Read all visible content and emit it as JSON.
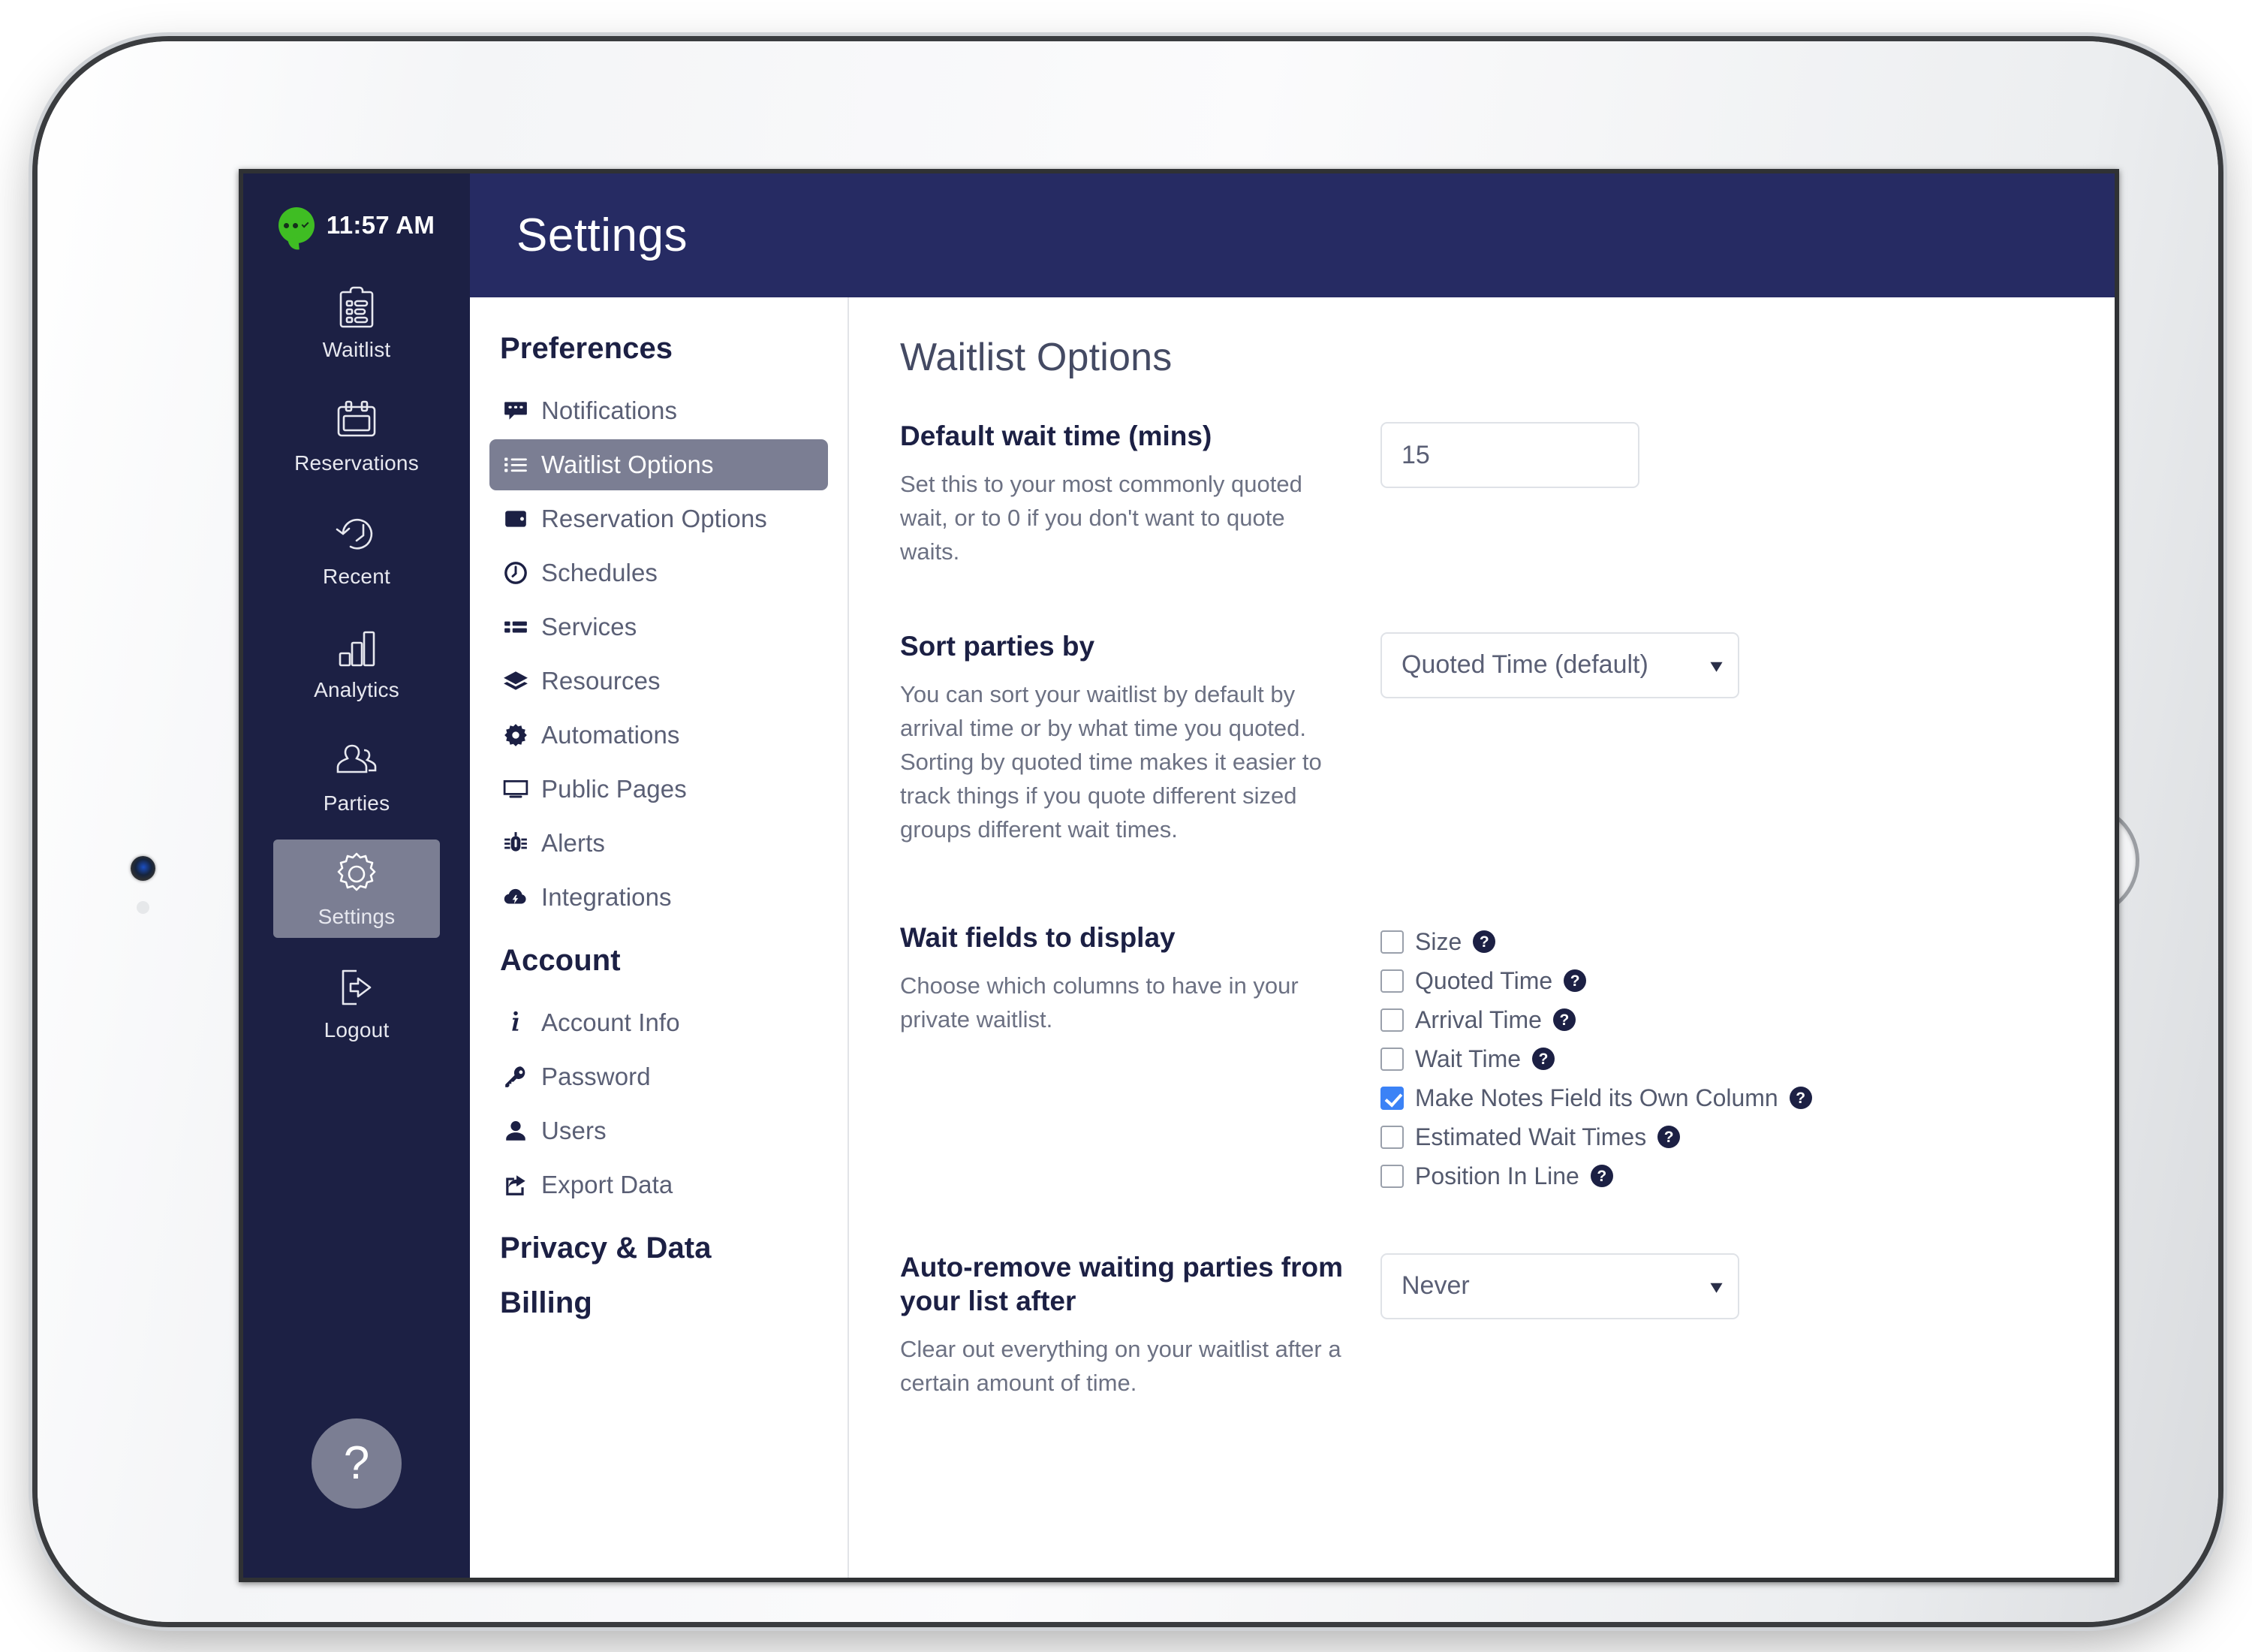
{
  "device": {
    "home_button": "home-button",
    "camera": "front-camera"
  },
  "status_bar": {
    "time": "11:57 AM",
    "logo_icon": "chat-bubble-logo"
  },
  "icon_rail": {
    "items": [
      {
        "label": "Waitlist",
        "icon": "clipboard-list-icon",
        "active": false
      },
      {
        "label": "Reservations",
        "icon": "calendar-icon",
        "active": false
      },
      {
        "label": "Recent",
        "icon": "clock-back-icon",
        "active": false
      },
      {
        "label": "Analytics",
        "icon": "bar-chart-icon",
        "active": false
      },
      {
        "label": "Parties",
        "icon": "people-icon",
        "active": false
      },
      {
        "label": "Settings",
        "icon": "gear-icon",
        "active": true
      },
      {
        "label": "Logout",
        "icon": "logout-icon",
        "active": false
      }
    ],
    "help_label": "?"
  },
  "title_bar": {
    "title": "Settings"
  },
  "prefs": {
    "heading_preferences": "Preferences",
    "heading_account": "Account",
    "heading_privacy": "Privacy & Data",
    "heading_billing": "Billing",
    "preferences_items": [
      {
        "label": "Notifications",
        "icon": "comment-icon",
        "active": false
      },
      {
        "label": "Waitlist Options",
        "icon": "list-icon",
        "active": true
      },
      {
        "label": "Reservation Options",
        "icon": "wallet-icon",
        "active": false
      },
      {
        "label": "Schedules",
        "icon": "clock-icon",
        "active": false
      },
      {
        "label": "Services",
        "icon": "th-list-icon",
        "active": false
      },
      {
        "label": "Resources",
        "icon": "layers-icon",
        "active": false
      },
      {
        "label": "Automations",
        "icon": "cog-icon",
        "active": false
      },
      {
        "label": "Public Pages",
        "icon": "monitor-icon",
        "active": false
      },
      {
        "label": "Alerts",
        "icon": "bug-icon",
        "active": false
      },
      {
        "label": "Integrations",
        "icon": "cloud-bolt-icon",
        "active": false
      }
    ],
    "account_items": [
      {
        "label": "Account Info",
        "icon": "info-icon",
        "active": false
      },
      {
        "label": "Password",
        "icon": "key-icon",
        "active": false
      },
      {
        "label": "Users",
        "icon": "user-icon",
        "active": false
      },
      {
        "label": "Export Data",
        "icon": "export-icon",
        "active": false
      }
    ]
  },
  "main": {
    "title": "Waitlist Options",
    "default_wait": {
      "title": "Default wait time (mins)",
      "description": "Set this to your most commonly quoted wait, or to 0 if you don't want to quote waits.",
      "value": "15",
      "placeholder": "15"
    },
    "sort_parties": {
      "title": "Sort parties by",
      "description": "You can sort your waitlist by default by arrival time or by what time you quoted. Sorting by quoted time makes it easier to track things if you quote different sized groups different wait times.",
      "selected": "Quoted Time (default)"
    },
    "wait_fields": {
      "title": "Wait fields to display",
      "description": "Choose which columns to have in your private waitlist.",
      "checkboxes": [
        {
          "label": "Size",
          "checked": false
        },
        {
          "label": "Quoted Time",
          "checked": false
        },
        {
          "label": "Arrival Time",
          "checked": false
        },
        {
          "label": "Wait Time",
          "checked": false
        },
        {
          "label": "Make Notes Field its Own Column",
          "checked": true
        },
        {
          "label": "Estimated Wait Times",
          "checked": false
        },
        {
          "label": "Position In Line",
          "checked": false
        }
      ]
    },
    "auto_remove": {
      "title": "Auto-remove waiting parties from your list after",
      "description": "Clear out everything on your waitlist after a certain amount of time.",
      "selected": "Never"
    }
  },
  "colors": {
    "rail_bg": "#1c2044",
    "title_bar_bg": "#262b63",
    "active_highlight": "#7b7e93",
    "checkbox_checked": "#3b82f6",
    "brand_green": "#3fbd23"
  }
}
